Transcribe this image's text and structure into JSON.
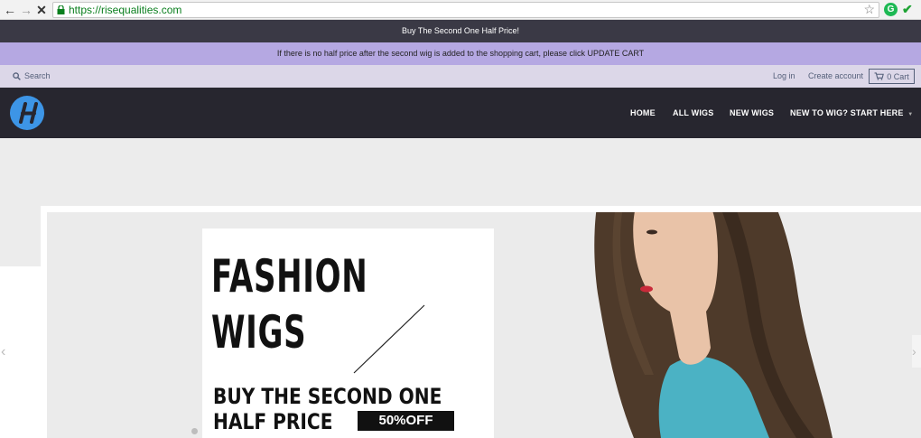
{
  "browser": {
    "url": "https://risequalities.com",
    "back_icon": "arrow-left-icon",
    "forward_icon": "arrow-right-icon",
    "stop_icon": "close-icon"
  },
  "announcement": {
    "primary": "Buy The Second One Half Price!",
    "secondary": "If there is no half price after the second wig is added to the shopping cart, please click UPDATE CART"
  },
  "utility": {
    "search_label": "Search",
    "login_label": "Log in",
    "create_account_label": "Create account",
    "cart_label": "0 Cart"
  },
  "nav": {
    "items": [
      {
        "label": "HOME"
      },
      {
        "label": "ALL WIGS"
      },
      {
        "label": "NEW WIGS"
      },
      {
        "label": "NEW TO WIG? START HERE"
      }
    ]
  },
  "hero": {
    "headline_line1": "FASHION",
    "headline_line2": "WIGS",
    "promo_line1": "BUY THE SECOND ONE",
    "promo_line2": "HALF PRICE",
    "badge": "50%OFF"
  },
  "colors": {
    "announcement_dark": "#3a3945",
    "announcement_purple": "#b5a8e2",
    "utility_bg": "#dcd7e8",
    "header_bg": "#27262f",
    "logo_blue": "#3d95e6"
  }
}
